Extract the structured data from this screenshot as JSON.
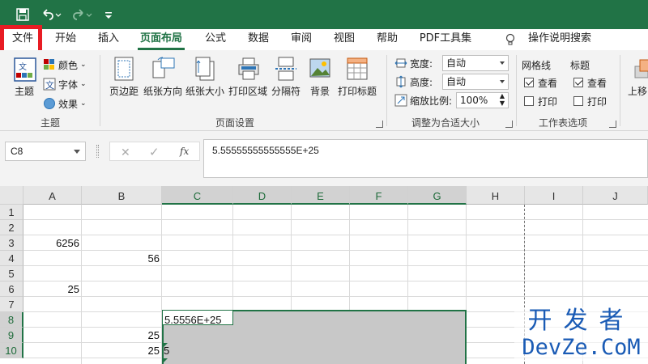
{
  "tabs": [
    "文件",
    "开始",
    "插入",
    "页面布局",
    "公式",
    "数据",
    "审阅",
    "视图",
    "帮助",
    "PDF工具集"
  ],
  "active_tab": "页面布局",
  "search_label": "操作说明搜索",
  "colors": {
    "accent": "#217346",
    "highlight": "#e81c24",
    "watermark": "#1a5bb5"
  },
  "ribbon": {
    "themes": {
      "themes_button": "主题",
      "colors_button": "颜色",
      "fonts_button": "字体",
      "effects_button": "效果",
      "group_label": "主题"
    },
    "page_setup": {
      "buttons": [
        "页边距",
        "纸张方向",
        "纸张大小",
        "打印区域",
        "分隔符",
        "背景",
        "打印标题"
      ],
      "group_label": "页面设置"
    },
    "scale_to_fit": {
      "width_label": "宽度:",
      "width_value": "自动",
      "height_label": "高度:",
      "height_value": "自动",
      "scale_label": "缩放比例:",
      "scale_value": "100%",
      "group_label": "调整为合适大小"
    },
    "sheet_options": {
      "gridlines_title": "网格线",
      "headings_title": "标题",
      "view_label": "查看",
      "print_label": "打印",
      "gridlines_view_checked": true,
      "gridlines_print_checked": false,
      "headings_view_checked": true,
      "headings_print_checked": false,
      "group_label": "工作表选项"
    },
    "arrange": {
      "bring_forward": "上移"
    }
  },
  "formula_bar": {
    "name_box": "C8",
    "fx_label": "fx",
    "formula": "5.55555555555555E+25"
  },
  "sheet": {
    "columns": [
      "A",
      "B",
      "C",
      "D",
      "E",
      "F",
      "G",
      "H",
      "I",
      "J"
    ],
    "rows": [
      "1",
      "2",
      "3",
      "4",
      "5",
      "6",
      "7",
      "8",
      "9",
      "10"
    ],
    "cells": {
      "A3": "6256",
      "B4": "56",
      "A6": "25",
      "C8": "5.5556E+25",
      "B9": "25",
      "B10": "25",
      "C10": "5"
    }
  },
  "watermark": {
    "line1": "开发者",
    "line2": "DevZe.CoM"
  }
}
